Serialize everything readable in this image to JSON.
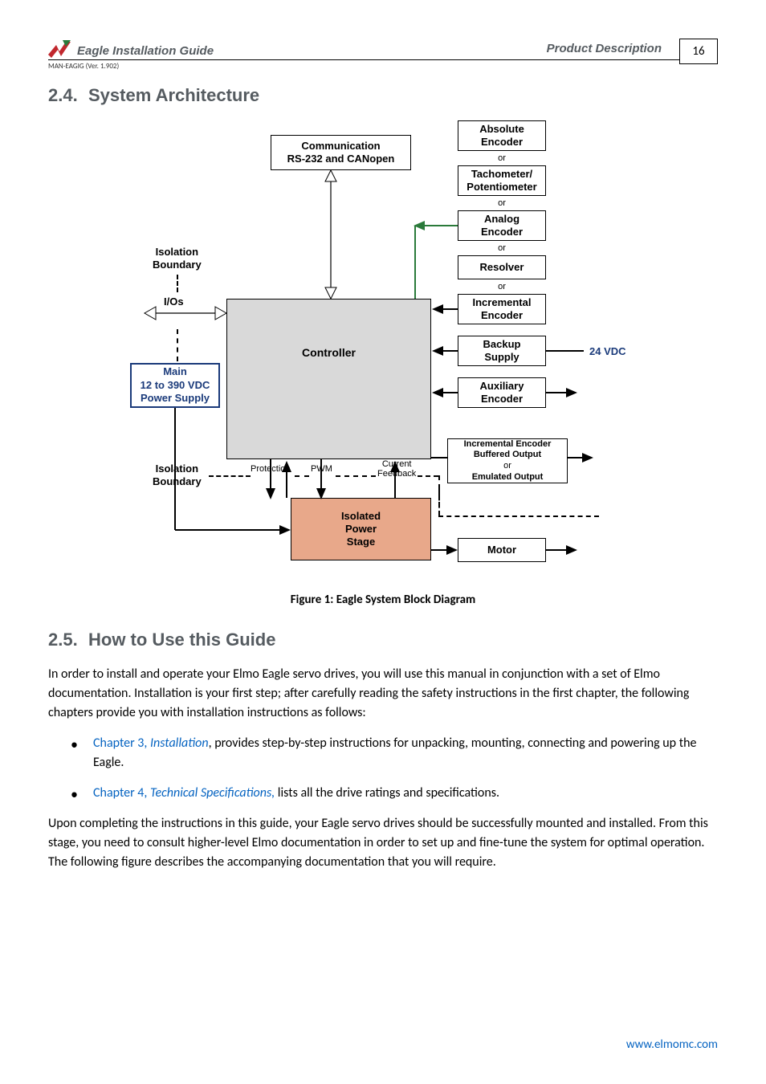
{
  "header": {
    "doc_title": "Eagle Installation Guide",
    "section_label": "Product Description",
    "man_version": "MAN-EAGIG (Ver. 1.902)",
    "page_number": "16"
  },
  "sections": {
    "s24_num": "2.4.",
    "s24_title": "System Architecture",
    "s25_num": "2.5.",
    "s25_title": "How to Use this Guide"
  },
  "diagram": {
    "comm_l1": "Communication",
    "comm_l2": "RS-232 and CANopen",
    "abs_l1": "Absolute",
    "abs_l2": "Encoder",
    "tach_l1": "Tachometer/",
    "tach_l2": "Potentiometer",
    "analog_l1": "Analog",
    "analog_l2": "Encoder",
    "resolver": "Resolver",
    "inc_l1": "Incremental",
    "inc_l2": "Encoder",
    "backup_l1": "Backup",
    "backup_l2": "Supply",
    "aux_l1": "Auxiliary",
    "aux_l2": "Encoder",
    "ibuf_l1": "Incremental Encoder",
    "ibuf_l2": "Buffered Output",
    "ibuf_or": "or",
    "ibuf_l3": "Emulated Output",
    "motor": "Motor",
    "controller": "Controller",
    "iso_power_l1": "Isolated",
    "iso_power_l2": "Power",
    "iso_power_l3": "Stage",
    "ios": "I/Os",
    "iso_bound_l1": "Isolation",
    "iso_bound_l2": "Boundary",
    "main_l1": "Main",
    "main_l2": "12 to 390 VDC",
    "main_l3": "Power Supply",
    "vdc24": "24 VDC",
    "or": "or",
    "protection": "Protection",
    "pwm": "PWM",
    "cur_l1": "Current",
    "cur_l2": "Feedback"
  },
  "figure_caption": "Figure 1: Eagle System Block Diagram",
  "body": {
    "p1": "In order to install and operate your Elmo Eagle servo drives, you will use this manual in conjunction with a set of Elmo documentation. Installation is your first step; after carefully reading the safety instructions in the first chapter, the following chapters provide you with installation instructions as follows:",
    "b1_ch": "Chapter 3, ",
    "b1_title": "Installation",
    "b1_rest": ", provides step-by-step instructions for unpacking, mounting, connecting and powering up the Eagle.",
    "b2_ch": "Chapter 4, ",
    "b2_title": "Technical Specifications,",
    "b2_rest": " lists all the drive ratings and specifications.",
    "p2": "Upon completing the instructions in this guide, your Eagle servo drives should be successfully mounted and installed. From this stage, you need to consult higher-level Elmo documentation in order to set up and fine-tune the system for optimal operation. The following figure describes the accompanying documentation that you will require."
  },
  "footer_url": "www.elmomc.com"
}
